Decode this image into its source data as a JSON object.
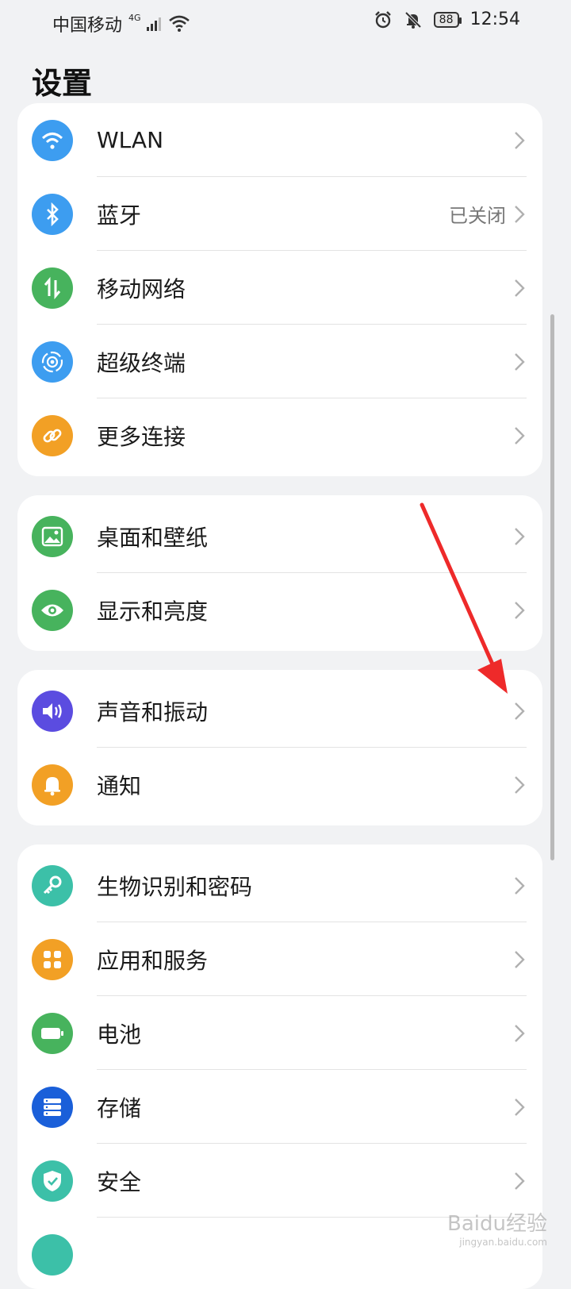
{
  "status_bar": {
    "carrier": "中国移动",
    "network": "4G",
    "battery": "88",
    "time": "12:54"
  },
  "page_title": "设置",
  "groups": [
    {
      "items": [
        {
          "label": "WLAN",
          "icon": "wifi-icon",
          "color": "#3d9df0"
        },
        {
          "label": "蓝牙",
          "icon": "bluetooth-icon",
          "color": "#3d9df0",
          "value": "已关闭"
        },
        {
          "label": "移动网络",
          "icon": "mobile-network-icon",
          "color": "#47b35d"
        },
        {
          "label": "超级终端",
          "icon": "super-device-icon",
          "color": "#3d9df0"
        },
        {
          "label": "更多连接",
          "icon": "link-icon",
          "color": "#f2a025"
        }
      ]
    },
    {
      "items": [
        {
          "label": "桌面和壁纸",
          "icon": "wallpaper-icon",
          "color": "#47b35d"
        },
        {
          "label": "显示和亮度",
          "icon": "eye-icon",
          "color": "#47b35d"
        }
      ]
    },
    {
      "items": [
        {
          "label": "声音和振动",
          "icon": "speaker-icon",
          "color": "#5b4ce0"
        },
        {
          "label": "通知",
          "icon": "bell-icon",
          "color": "#f2a025"
        }
      ]
    },
    {
      "items": [
        {
          "label": "生物识别和密码",
          "icon": "key-icon",
          "color": "#3cc0a8"
        },
        {
          "label": "应用和服务",
          "icon": "apps-icon",
          "color": "#f2a025"
        },
        {
          "label": "电池",
          "icon": "battery-icon",
          "color": "#47b35d"
        },
        {
          "label": "存储",
          "icon": "storage-icon",
          "color": "#1a5fd9"
        },
        {
          "label": "安全",
          "icon": "shield-icon",
          "color": "#3cc0a8"
        }
      ]
    }
  ],
  "watermark": {
    "brand": "Baidu经验",
    "url": "jingyan.baidu.com"
  }
}
